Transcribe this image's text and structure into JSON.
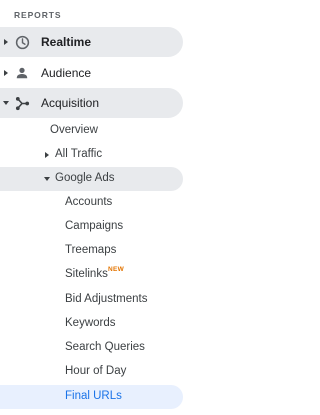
{
  "reports_header": "REPORTS",
  "top_items": {
    "realtime": "Realtime",
    "audience": "Audience",
    "acquisition": "Acquisition"
  },
  "acquisition_children": {
    "overview": "Overview",
    "all_traffic": "All Traffic",
    "google_ads": "Google Ads"
  },
  "google_ads_children": {
    "accounts": "Accounts",
    "campaigns": "Campaigns",
    "treemaps": "Treemaps",
    "sitelinks": "Sitelinks",
    "sitelinks_badge": "NEW",
    "bid_adjustments": "Bid Adjustments",
    "keywords": "Keywords",
    "search_queries": "Search Queries",
    "hour_of_day": "Hour of Day",
    "final_urls": "Final URLs"
  },
  "colors": {
    "hover_bg": "#e8eaed",
    "selected_bg": "#e8f0fe",
    "selected_text": "#1a73e8",
    "badge": "#e37400"
  },
  "icons": {
    "realtime": "clock-icon",
    "audience": "person-icon",
    "acquisition": "acquisition-icon"
  }
}
